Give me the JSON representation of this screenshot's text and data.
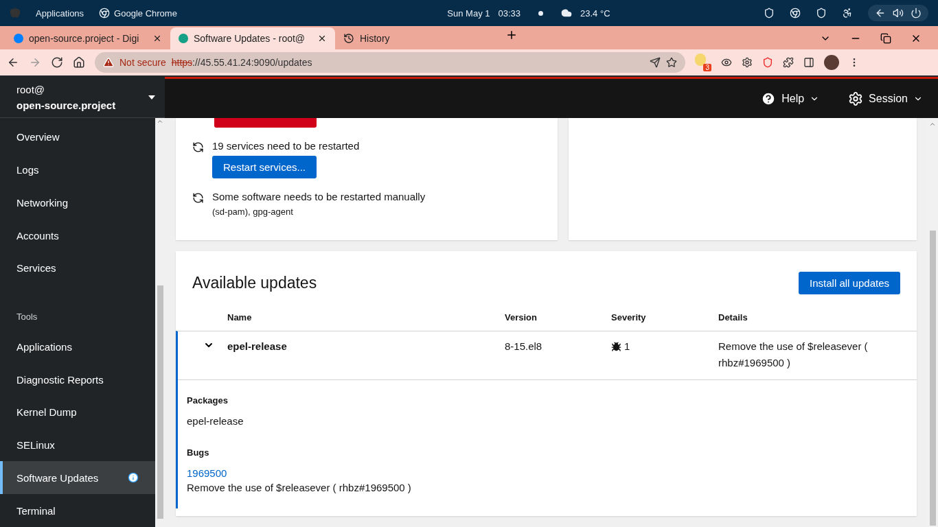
{
  "os_bar": {
    "menu": "Applications",
    "app": "Google Chrome",
    "date": "Sun May 1",
    "time": "03:33",
    "weather": "23.4 °C"
  },
  "browser_tabs": [
    {
      "title": "open-source.project - Digi",
      "selected": false
    },
    {
      "title": "Software Updates - root@",
      "selected": true
    },
    {
      "title": "History",
      "selected": false
    }
  ],
  "address_bar": {
    "security": "Not secure",
    "scheme": "https",
    "rest": "://45.55.41.24:9090/updates"
  },
  "extension_badge": "3",
  "host": {
    "user": "root@",
    "name": "open-source.project"
  },
  "header": {
    "help": "Help",
    "session": "Session"
  },
  "nav": [
    {
      "kind": "item",
      "label": "Overview",
      "selected": false
    },
    {
      "kind": "item",
      "label": "Logs",
      "selected": false
    },
    {
      "kind": "item",
      "label": "Networking",
      "selected": false
    },
    {
      "kind": "item",
      "label": "Accounts",
      "selected": false
    },
    {
      "kind": "item",
      "label": "Services",
      "selected": false
    },
    {
      "kind": "heading",
      "label": "Tools"
    },
    {
      "kind": "item",
      "label": "Applications",
      "selected": false
    },
    {
      "kind": "item",
      "label": "Diagnostic Reports",
      "selected": false
    },
    {
      "kind": "item",
      "label": "Kernel Dump",
      "selected": false
    },
    {
      "kind": "item",
      "label": "SELinux",
      "selected": false
    },
    {
      "kind": "item",
      "label": "Software Updates",
      "selected": true,
      "info": true
    },
    {
      "kind": "item",
      "label": "Terminal",
      "selected": false
    }
  ],
  "restart": [
    {
      "text": "19 services need to be restarted",
      "button": "Restart services..."
    },
    {
      "text": "Some software needs to be restarted manually",
      "detail": "(sd-pam), gpg-agent"
    }
  ],
  "updates": {
    "title": "Available updates",
    "button": "Install all updates",
    "columns": [
      "Name",
      "Version",
      "Severity",
      "Details"
    ],
    "rows": [
      {
        "name": "epel-release",
        "version": "8-15.el8",
        "severity": "1",
        "details": "Remove the use of $releasever ( rhbz#1969500 )",
        "expanded": true,
        "packages_label": "Packages",
        "packages": "epel-release",
        "bugs_label": "Bugs",
        "bug_link": "1969500",
        "bug_text": "Remove the use of $releasever ( rhbz#1969500 )"
      }
    ]
  }
}
